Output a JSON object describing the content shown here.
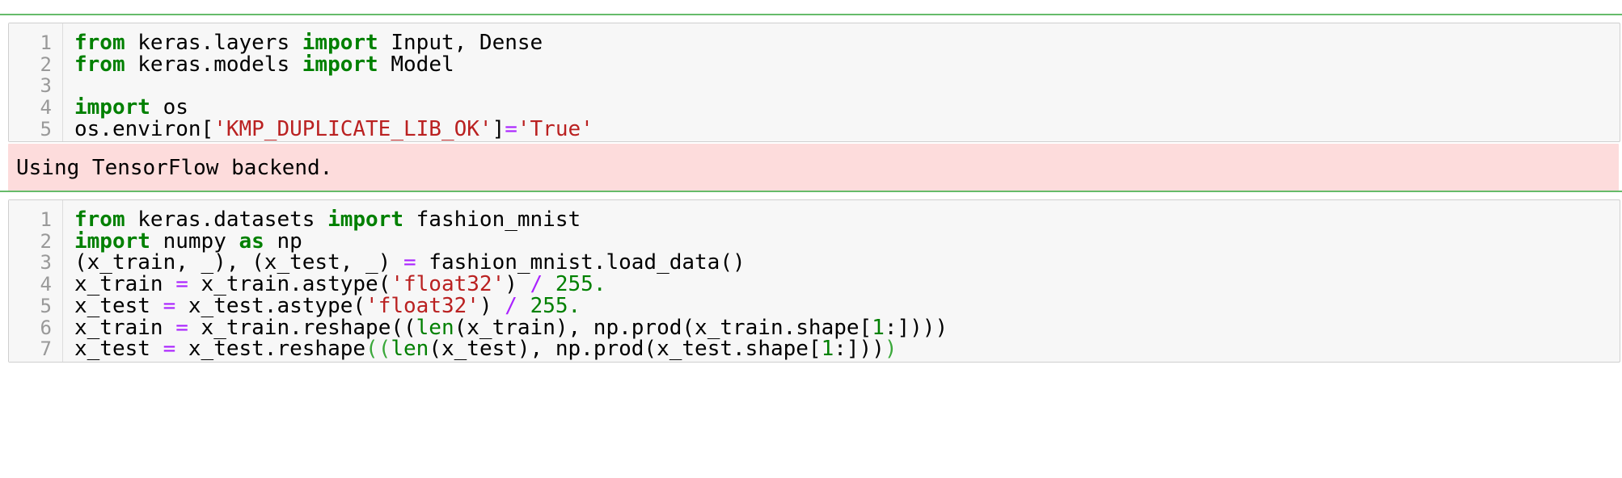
{
  "cells": [
    {
      "line_numbers": [
        "1",
        "2",
        "3",
        "4",
        "5"
      ],
      "lines": [
        [
          {
            "t": "from",
            "c": "kw"
          },
          {
            "t": " keras.layers "
          },
          {
            "t": "import",
            "c": "kw"
          },
          {
            "t": " Input, Dense"
          }
        ],
        [
          {
            "t": "from",
            "c": "kw"
          },
          {
            "t": " keras.models "
          },
          {
            "t": "import",
            "c": "kw"
          },
          {
            "t": " Model"
          }
        ],
        [],
        [
          {
            "t": "import",
            "c": "kw"
          },
          {
            "t": " os"
          }
        ],
        [
          {
            "t": "os.environ["
          },
          {
            "t": "'KMP_DUPLICATE_LIB_OK'",
            "c": "str"
          },
          {
            "t": "]"
          },
          {
            "t": "=",
            "c": "op"
          },
          {
            "t": "'True'",
            "c": "str"
          }
        ]
      ],
      "output": "Using TensorFlow backend."
    },
    {
      "line_numbers": [
        "1",
        "2",
        "3",
        "4",
        "5",
        "6",
        "7"
      ],
      "lines": [
        [
          {
            "t": "from",
            "c": "kw"
          },
          {
            "t": " keras.datasets "
          },
          {
            "t": "import",
            "c": "kw"
          },
          {
            "t": " fashion_mnist"
          }
        ],
        [
          {
            "t": "import",
            "c": "kw"
          },
          {
            "t": " numpy "
          },
          {
            "t": "as",
            "c": "kw"
          },
          {
            "t": " np"
          }
        ],
        [
          {
            "t": "(x_train, _), (x_test, _) "
          },
          {
            "t": "=",
            "c": "op"
          },
          {
            "t": " fashion_mnist.load_data()"
          }
        ],
        [
          {
            "t": "x_train "
          },
          {
            "t": "=",
            "c": "op"
          },
          {
            "t": " x_train.astype("
          },
          {
            "t": "'float32'",
            "c": "str"
          },
          {
            "t": ") "
          },
          {
            "t": "/",
            "c": "op"
          },
          {
            "t": " "
          },
          {
            "t": "255.",
            "c": "num"
          }
        ],
        [
          {
            "t": "x_test "
          },
          {
            "t": "=",
            "c": "op"
          },
          {
            "t": " x_test.astype("
          },
          {
            "t": "'float32'",
            "c": "str"
          },
          {
            "t": ") "
          },
          {
            "t": "/",
            "c": "op"
          },
          {
            "t": " "
          },
          {
            "t": "255.",
            "c": "num"
          }
        ],
        [
          {
            "t": "x_train "
          },
          {
            "t": "=",
            "c": "op"
          },
          {
            "t": " x_train.reshape(("
          },
          {
            "t": "len",
            "c": "bi"
          },
          {
            "t": "(x_train), np.prod(x_train.shape["
          },
          {
            "t": "1",
            "c": "num"
          },
          {
            "t": ":])))"
          }
        ],
        [
          {
            "t": "x_test "
          },
          {
            "t": "=",
            "c": "op"
          },
          {
            "t": " x_test.reshape"
          },
          {
            "t": "((",
            "c": "hl"
          },
          {
            "t": "len",
            "c": "bi"
          },
          {
            "t": "(x_test), np.prod(x_test.shape["
          },
          {
            "t": "1",
            "c": "num"
          },
          {
            "t": ":]))"
          },
          {
            "t": ")",
            "c": "hl"
          }
        ]
      ],
      "output": null
    }
  ],
  "colors": {
    "keyword": "#008000",
    "string": "#ba2121",
    "operator": "#aa22ff",
    "number": "#008000",
    "stderr_bg": "#fddcdc",
    "separator": "#66bb6a"
  }
}
